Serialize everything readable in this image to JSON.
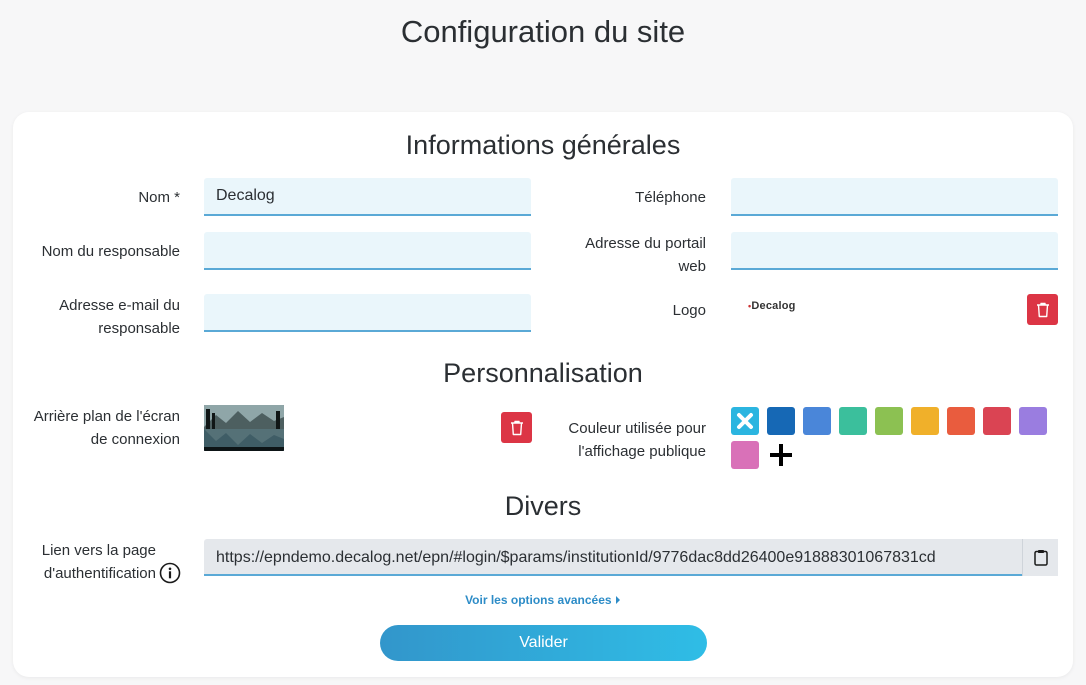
{
  "page": {
    "title": "Configuration du site"
  },
  "general": {
    "title": "Informations générales",
    "nom_label": "Nom *",
    "nom_value": "Decalog",
    "responsable_label": "Nom du responsable",
    "responsable_value": "",
    "email_label": "Adresse e-mail du responsable",
    "email_value": "",
    "telephone_label": "Téléphone",
    "telephone_value": "",
    "portail_label": "Adresse du portail web",
    "portail_value": "",
    "logo_label": "Logo",
    "logo_text": "Decalog"
  },
  "personnalisation": {
    "title": "Personnalisation",
    "background_label": "Arrière plan de l'écran de connexion",
    "color_label": "Couleur utilisée pour l'affichage publique",
    "colors": [
      "#2bb5e0",
      "#1668b5",
      "#4a86d9",
      "#3bbf9c",
      "#8cc152",
      "#f0b02a",
      "#e95c3e",
      "#da4453",
      "#9a7de0",
      "#d971b8"
    ],
    "selected_color_index": 0
  },
  "divers": {
    "title": "Divers",
    "link_label": "Lien vers la page d'authentification",
    "link_value": "https://epndemo.decalog.net/epn/#login/$params/institutionId/9776dac8dd26400e91888301067831cd",
    "advanced_label": "Voir les options avancées"
  },
  "actions": {
    "submit_label": "Valider"
  },
  "icons": {
    "trash": "trash-icon",
    "copy": "clipboard-icon",
    "info": "info-icon",
    "add": "plus-icon",
    "selected": "x-icon",
    "caret": "caret-right-icon"
  }
}
